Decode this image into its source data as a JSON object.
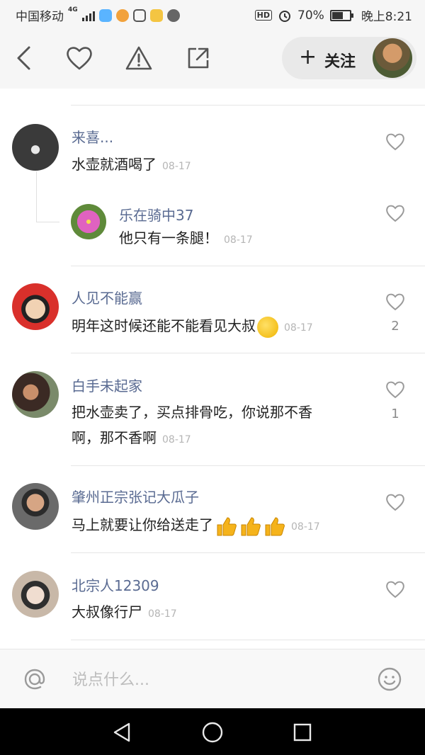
{
  "status_bar": {
    "carrier": "中国移动",
    "network": "4G",
    "hd": "HD",
    "battery_text": "70%",
    "battery_level": 0.7,
    "time": "晚上8:21"
  },
  "header": {
    "follow_label": "关注",
    "follow_icon": "plus-icon",
    "icons": [
      "back-arrow-icon",
      "heart-icon",
      "warning-icon",
      "share-icon"
    ]
  },
  "comments": [
    {
      "user": "来喜...",
      "text": "水壶就酒喝了",
      "date": "08-17",
      "likes": ""
    },
    {
      "user": "乐在骑中37",
      "text": "他只有一条腿！",
      "date": "08-17",
      "likes": "",
      "is_reply": true
    },
    {
      "user": "人见不能赢",
      "text": "明年这时候还能不能看见大叔",
      "date": "08-17",
      "likes": "2",
      "emoji": "grin-emoji"
    },
    {
      "user": "白手未起家",
      "text_line1": "把水壶卖了，买点排骨吃，你说那不香",
      "text_line2": "啊，那不香啊",
      "date": "08-17",
      "likes": "1"
    },
    {
      "user": "肇州正宗张记大瓜子",
      "text": "马上就要让你给送走了",
      "date": "08-17",
      "likes": "",
      "emoji": "thumbs-up-emoji"
    },
    {
      "user": "北宗人12309",
      "text": "大叔像行尸",
      "date": "08-17",
      "likes": ""
    }
  ],
  "input_bar": {
    "placeholder": "说点什么...",
    "left_icon": "at-icon",
    "right_icon": "smiley-icon"
  },
  "nav_bar": {
    "icons": [
      "nav-back-icon",
      "nav-home-icon",
      "nav-recents-icon"
    ]
  }
}
